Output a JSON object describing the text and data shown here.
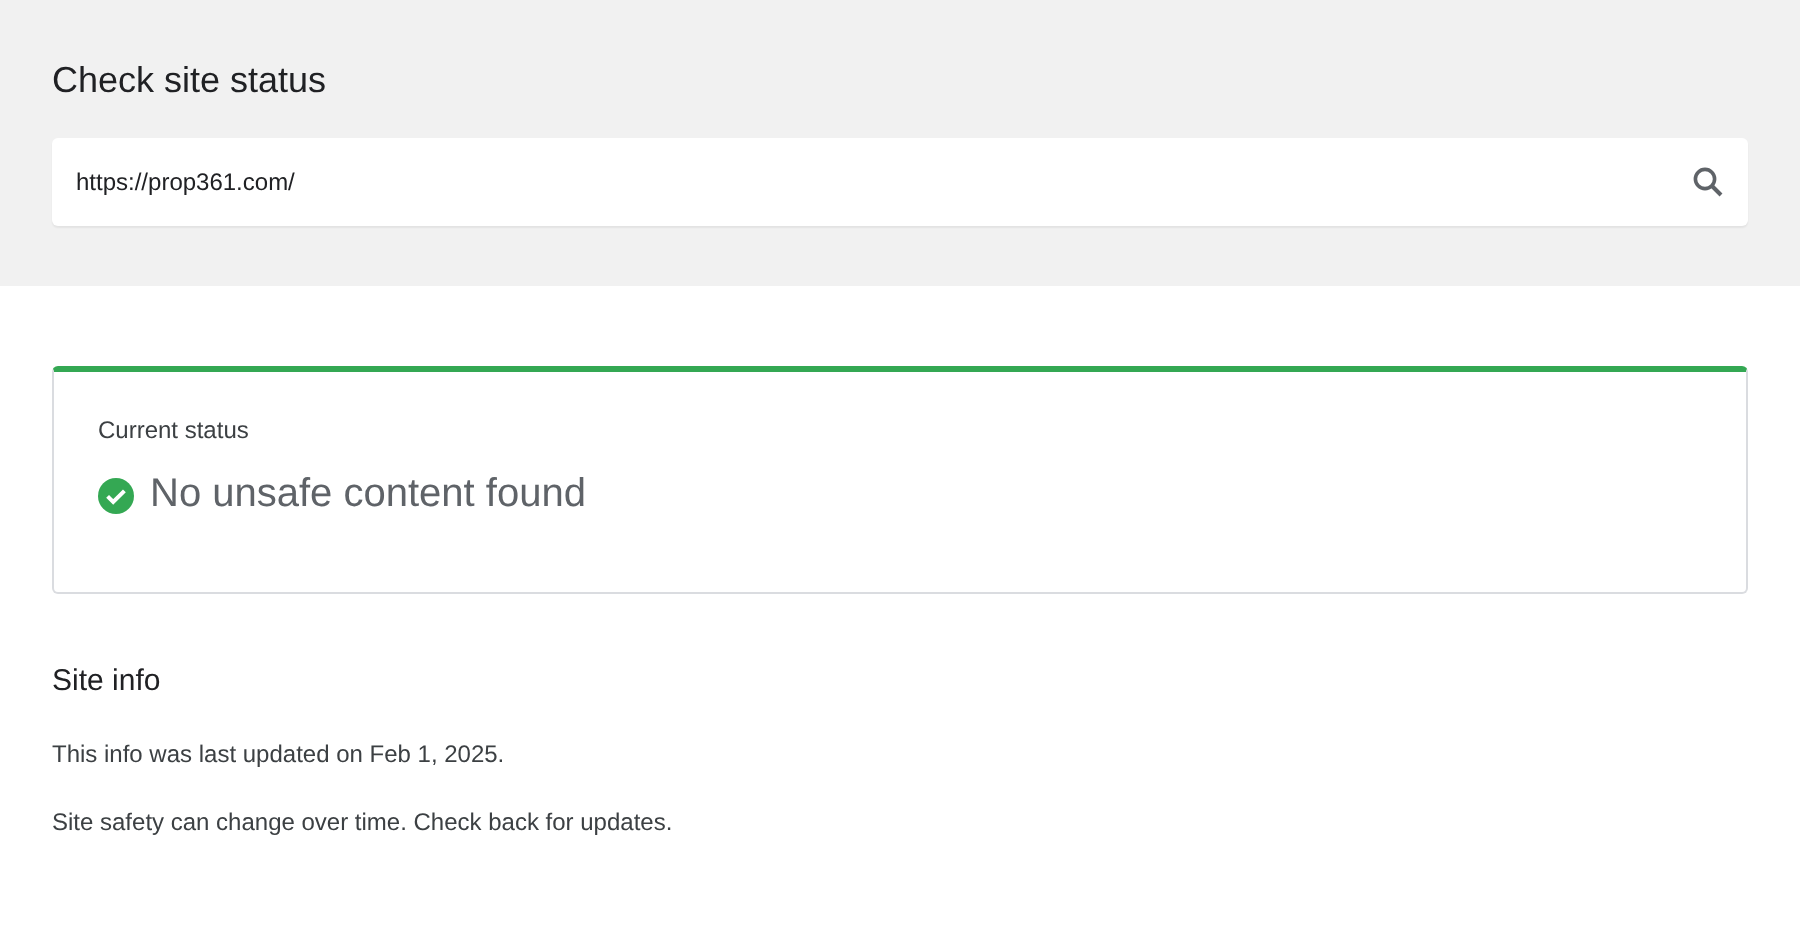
{
  "header": {
    "title": "Check site status",
    "search": {
      "value": "https://prop361.com/"
    }
  },
  "status": {
    "label": "Current status",
    "text": "No unsafe content found",
    "safe": true
  },
  "site_info": {
    "heading": "Site info",
    "lines": [
      "This info was last updated on Feb 1, 2025.",
      "Site safety can change over time. Check back for updates."
    ]
  }
}
